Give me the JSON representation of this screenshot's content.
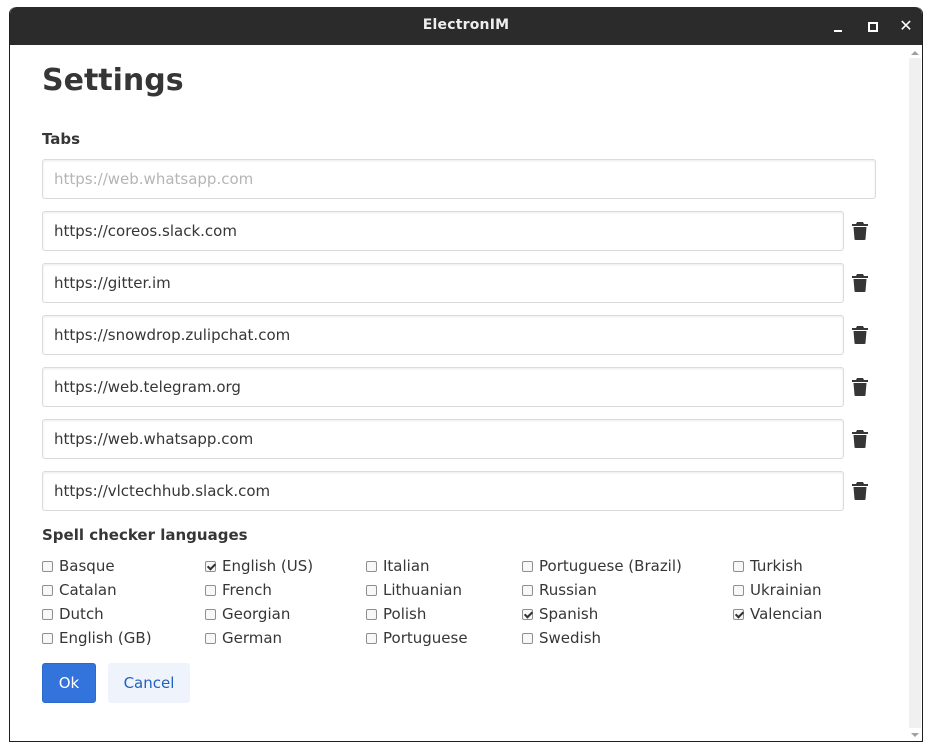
{
  "window": {
    "title": "ElectronIM",
    "controls": {
      "minimize": "minimize-icon",
      "maximize": "maximize-icon",
      "close": "close-icon"
    }
  },
  "page": {
    "title": "Settings"
  },
  "tabs_section": {
    "label": "Tabs",
    "new_tab_placeholder": "https://web.whatsapp.com",
    "new_tab_value": "",
    "tabs": [
      {
        "url": "https://coreos.slack.com",
        "delete_icon": "trash-icon"
      },
      {
        "url": "https://gitter.im",
        "delete_icon": "trash-icon"
      },
      {
        "url": "https://snowdrop.zulipchat.com",
        "delete_icon": "trash-icon"
      },
      {
        "url": "https://web.telegram.org",
        "delete_icon": "trash-icon"
      },
      {
        "url": "https://web.whatsapp.com",
        "delete_icon": "trash-icon"
      },
      {
        "url": "https://vlctechhub.slack.com",
        "delete_icon": "trash-icon"
      }
    ]
  },
  "spell_section": {
    "label": "Spell checker languages",
    "columns": [
      [
        {
          "name": "Basque",
          "checked": false
        },
        {
          "name": "Catalan",
          "checked": false
        },
        {
          "name": "Dutch",
          "checked": false
        },
        {
          "name": "English (GB)",
          "checked": false
        }
      ],
      [
        {
          "name": "English (US)",
          "checked": true
        },
        {
          "name": "French",
          "checked": false
        },
        {
          "name": "Georgian",
          "checked": false
        },
        {
          "name": "German",
          "checked": false
        }
      ],
      [
        {
          "name": "Italian",
          "checked": false
        },
        {
          "name": "Lithuanian",
          "checked": false
        },
        {
          "name": "Polish",
          "checked": false
        },
        {
          "name": "Portuguese",
          "checked": false
        }
      ],
      [
        {
          "name": "Portuguese (Brazil)",
          "checked": false
        },
        {
          "name": "Russian",
          "checked": false
        },
        {
          "name": "Spanish",
          "checked": true
        },
        {
          "name": "Swedish",
          "checked": false
        }
      ],
      [
        {
          "name": "Turkish",
          "checked": false
        },
        {
          "name": "Ukrainian",
          "checked": false
        },
        {
          "name": "Valencian",
          "checked": true
        }
      ]
    ]
  },
  "buttons": {
    "ok": "Ok",
    "cancel": "Cancel"
  },
  "colors": {
    "primary": "#3273dc",
    "titlebar": "#2b2b2b",
    "text": "#363636"
  }
}
